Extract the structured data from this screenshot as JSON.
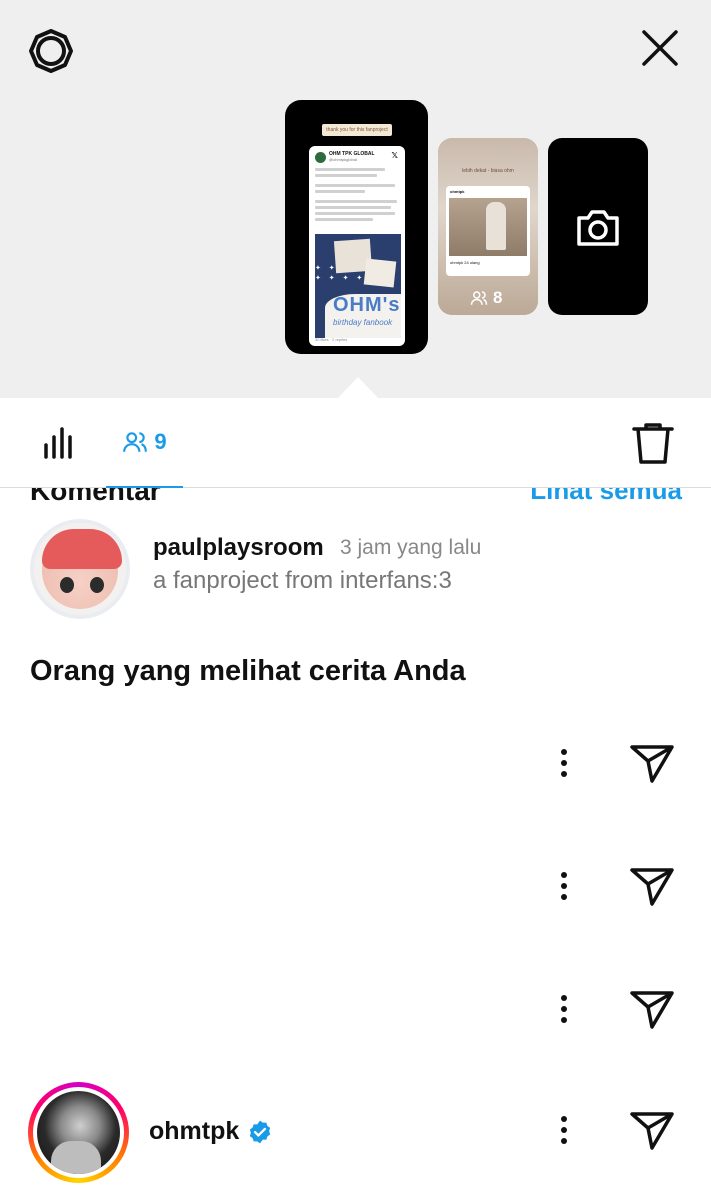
{
  "story_previews": {
    "main_banner": "thank you for this fanproject",
    "main_card": {
      "account": "OHM TPK GLOBAL",
      "handle": "@ohmtpkglobal",
      "art_title": "OHM's",
      "art_subtitle": "birthday fanbook",
      "footer": "30 likes · 2 replies"
    },
    "second_card": {
      "banner": "lebih dekat - biasa ohm",
      "account": "ohmtpk",
      "caption": "ohmtpk 24 ulang",
      "viewer_count": "8"
    }
  },
  "tabs": {
    "viewers_count": "9"
  },
  "comments": {
    "heading": "Komentar",
    "see_all": "Lihat semua",
    "item": {
      "username": "paulplaysroom",
      "time": "3 jam yang lalu",
      "text": "a fanproject from interfans:3"
    }
  },
  "viewers": {
    "heading": "Orang yang melihat cerita Anda",
    "last_viewer": {
      "username": "ohmtpk"
    }
  },
  "colors": {
    "accent": "#1a9be8",
    "background_top": "#efefef",
    "text_primary": "#111111",
    "text_secondary": "#888888"
  },
  "icons": [
    "settings-icon",
    "close-icon",
    "camera-icon",
    "viewers-icon",
    "stats-icon",
    "trash-icon",
    "more-icon",
    "send-icon",
    "verified-icon"
  ]
}
